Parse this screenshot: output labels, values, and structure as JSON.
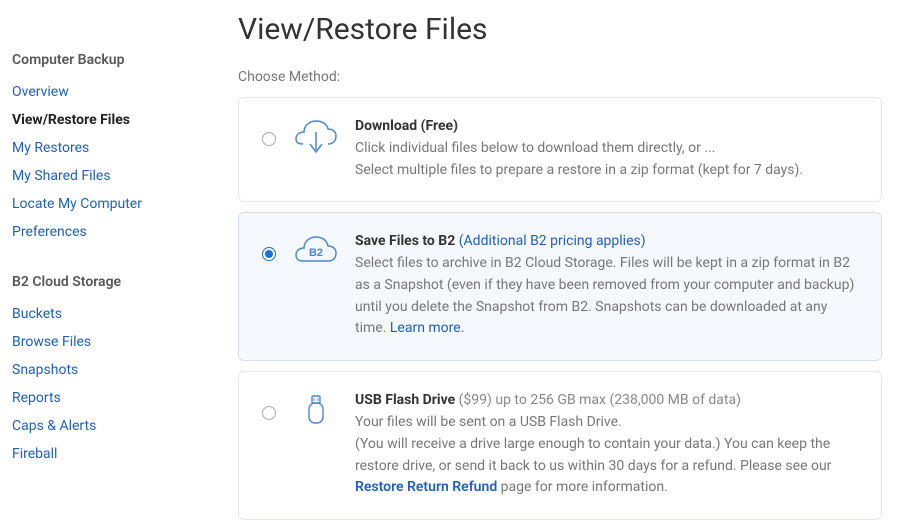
{
  "sidebar": {
    "section1_header": "Computer Backup",
    "section1_items": [
      {
        "label": "Overview",
        "active": false
      },
      {
        "label": "View/Restore Files",
        "active": true
      },
      {
        "label": "My Restores",
        "active": false
      },
      {
        "label": "My Shared Files",
        "active": false
      },
      {
        "label": "Locate My Computer",
        "active": false
      },
      {
        "label": "Preferences",
        "active": false
      }
    ],
    "section2_header": "B2 Cloud Storage",
    "section2_items": [
      {
        "label": "Buckets"
      },
      {
        "label": "Browse Files"
      },
      {
        "label": "Snapshots"
      },
      {
        "label": "Reports"
      },
      {
        "label": "Caps & Alerts"
      },
      {
        "label": "Fireball"
      }
    ]
  },
  "page": {
    "title": "View/Restore Files",
    "choose_label": "Choose Method:"
  },
  "methods": {
    "download": {
      "title": "Download (Free)",
      "line1": "Click individual files below to download them directly, or ...",
      "line2": "Select multiple files to prepare a restore in a zip format (kept for 7 days)."
    },
    "b2": {
      "title": "Save Files to B2",
      "title_extra": " (Additional B2 pricing applies)",
      "desc": "Select files to archive in B2 Cloud Storage. Files will be kept in a zip format in B2 as a Snapshot (even if they have been removed from your computer and backup) until you delete the Snapshot from B2. Snapshots can be downloaded at any time.",
      "learn_more": "Learn more."
    },
    "usb": {
      "title": "USB Flash Drive",
      "title_extra": " ($99) up to 256 GB max (238,000 MB of data)",
      "line1": "Your files will be sent on a USB Flash Drive.",
      "line2a": "(You will receive a drive large enough to contain your data.) You can keep the restore drive, or send it back to us within 30 days for a refund. Please see our ",
      "refund_link": "Restore Return Refund",
      "line2b": " page for more information."
    }
  }
}
